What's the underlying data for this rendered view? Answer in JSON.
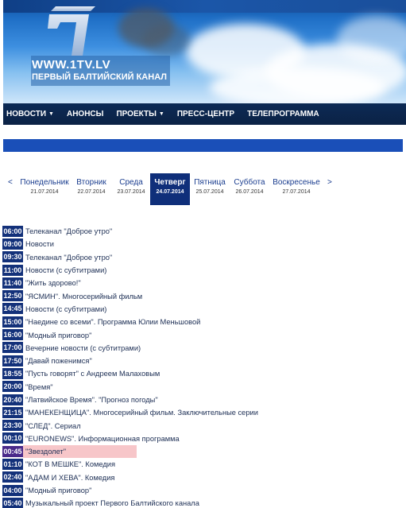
{
  "header": {
    "site_url": "WWW.1TV.LV",
    "site_name": "ПЕРВЫЙ БАЛТИЙСКИЙ КАНАЛ"
  },
  "nav": {
    "items": [
      {
        "label": "НОВОСТИ",
        "dropdown": true
      },
      {
        "label": "АНОНСЫ",
        "dropdown": false
      },
      {
        "label": "ПРОЕКТЫ",
        "dropdown": true
      },
      {
        "label": "ПРЕСС-ЦЕНТР",
        "dropdown": false
      },
      {
        "label": "ТЕЛЕПРОГРАММА",
        "dropdown": false
      }
    ]
  },
  "days": {
    "prev": "<",
    "next": ">",
    "items": [
      {
        "name": "Понедельник",
        "date": "21.07.2014"
      },
      {
        "name": "Вторник",
        "date": "22.07.2014"
      },
      {
        "name": "Среда",
        "date": "23.07.2014"
      },
      {
        "name": "Четверг",
        "date": "24.07.2014",
        "active": true
      },
      {
        "name": "Пятница",
        "date": "25.07.2014"
      },
      {
        "name": "Суббота",
        "date": "26.07.2014"
      },
      {
        "name": "Воскресенье",
        "date": "27.07.2014"
      }
    ]
  },
  "schedule": [
    {
      "time": "06:00",
      "title": "Телеканал \"Доброе утро\""
    },
    {
      "time": "09:00",
      "title": "Новости"
    },
    {
      "time": "09:30",
      "title": "Телеканал \"Доброе утро\""
    },
    {
      "time": "11:00",
      "title": "Новости (с субтитрами)"
    },
    {
      "time": "11:40",
      "title": "\"Жить здорово!\""
    },
    {
      "time": "12:50",
      "title": "\"ЯСМИН\". Многосерийный фильм"
    },
    {
      "time": "14:45",
      "title": "Новости (с субтитрами)"
    },
    {
      "time": "15:00",
      "title": "\"Наедине со всеми\". Программа Юлии Меньшовой"
    },
    {
      "time": "16:00",
      "title": "\"Модный приговор\""
    },
    {
      "time": "17:00",
      "title": "Вечерние новости (с субтитрами)"
    },
    {
      "time": "17:50",
      "title": "\"Давай поженимся\""
    },
    {
      "time": "18:55",
      "title": "\"Пусть говорят\" с Андреем Малаховым"
    },
    {
      "time": "20:00",
      "title": "\"Время\""
    },
    {
      "time": "20:40",
      "title": "\"Латвийское Время\". \"Прогноз погоды\""
    },
    {
      "time": "21:15",
      "title": "\"МАНЕКЕНЩИЦА\". Многосерийный фильм. Заключительные серии"
    },
    {
      "time": "23:30",
      "title": "\"СЛЕД\". Сериал"
    },
    {
      "time": "00:10",
      "title": "\"EURONEWS\". Информационная программа"
    },
    {
      "time": "00:45",
      "title": "\"Звездолет\"",
      "current": true
    },
    {
      "time": "01:10",
      "title": "\"КОТ В МЕШКЕ\". Комедия"
    },
    {
      "time": "02:40",
      "title": "\"АДАМ И ХЕВА\". Комедия"
    },
    {
      "time": "04:00",
      "title": "\"Модный приговор\""
    },
    {
      "time": "05:40",
      "title": "Музыкальный проект Первого Балтийского канала"
    }
  ],
  "colors": {
    "nav_bg": "#0b2245",
    "accent_blue": "#1a4fb8",
    "time_bg": "#13317a",
    "current_highlight": "#f7c6c9"
  }
}
